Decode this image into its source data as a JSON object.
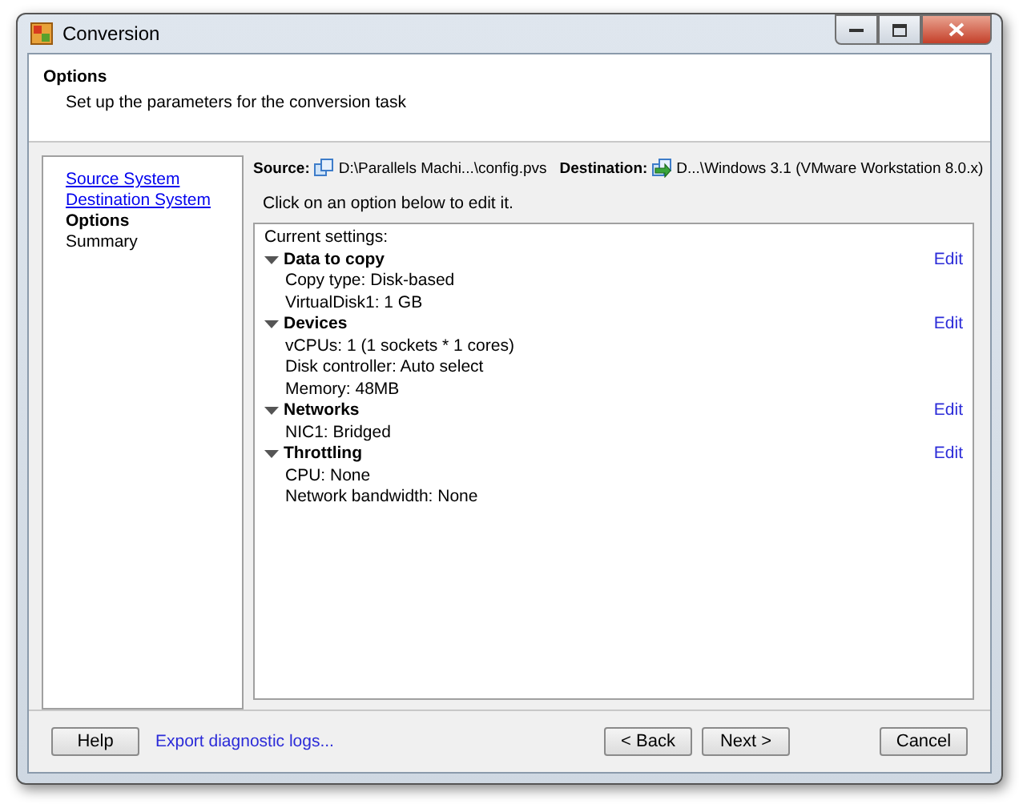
{
  "window": {
    "title": "Conversion"
  },
  "header": {
    "title": "Options",
    "subtitle": "Set up the parameters for the conversion task"
  },
  "steps": [
    {
      "label": "Source System",
      "kind": "link",
      "selected": false
    },
    {
      "label": "Destination System",
      "kind": "link",
      "selected": false
    },
    {
      "label": "Options",
      "kind": "plain",
      "selected": true
    },
    {
      "label": "Summary",
      "kind": "plain",
      "selected": false
    }
  ],
  "source": {
    "label": "Source:",
    "value": "D:\\Parallels Machi...\\config.pvs"
  },
  "destination": {
    "label": "Destination:",
    "value": "D...\\Windows 3.1 (VMware Workstation 8.0.x)"
  },
  "instruction": "Click on an option below to edit it.",
  "settings": {
    "title": "Current settings:",
    "groups": [
      {
        "title": "Data to copy",
        "expanded": true,
        "edit": "Edit",
        "items": [
          "Copy type: Disk-based",
          "VirtualDisk1: 1 GB"
        ]
      },
      {
        "title": "Devices",
        "expanded": true,
        "edit": "Edit",
        "items": [
          "vCPUs: 1 (1 sockets * 1 cores)",
          "Disk controller: Auto select",
          "Memory: 48MB"
        ]
      },
      {
        "title": "Networks",
        "expanded": true,
        "edit": "Edit",
        "items": [
          "NIC1: Bridged"
        ]
      },
      {
        "title": "Throttling",
        "expanded": true,
        "edit": "Edit",
        "items": [
          "CPU: None",
          "Network bandwidth: None"
        ]
      }
    ]
  },
  "footer": {
    "help": "Help",
    "export_link": "Export diagnostic logs...",
    "back": "< Back",
    "next": "Next >",
    "cancel": "Cancel"
  }
}
